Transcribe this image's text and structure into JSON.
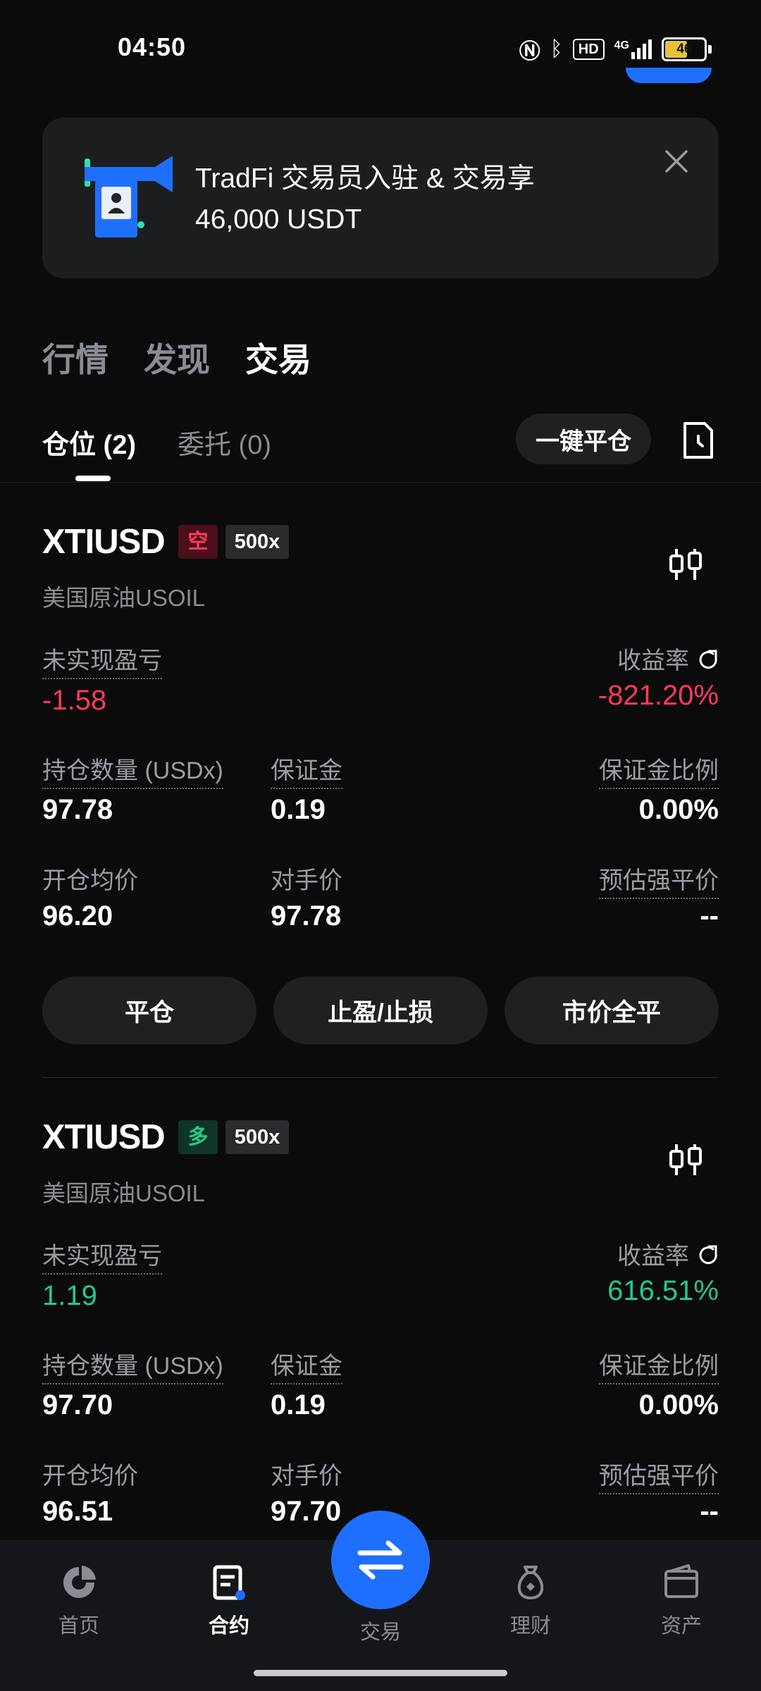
{
  "status": {
    "time": "04:50",
    "hd": "HD",
    "net": "4G",
    "battery": "46"
  },
  "banner": {
    "title": "TradFi 交易员入驻 & 交易享",
    "subtitle": "46,000 USDT"
  },
  "top_tabs": [
    "行情",
    "发现",
    "交易"
  ],
  "sub_tabs": {
    "positions": "仓位 (2)",
    "orders": "委托 (0)"
  },
  "close_all_label": "一键平仓",
  "positions": [
    {
      "symbol": "XTIUSD",
      "side": "空",
      "leverage": "500x",
      "name": "美国原油USOIL",
      "pnl_label": "未实现盈亏",
      "pnl": "-1.58",
      "roi_label": "收益率",
      "roi": "-821.20%",
      "qty_label": "持仓数量 (USDx)",
      "qty": "97.78",
      "margin_label": "保证金",
      "margin": "0.19",
      "margin_ratio_label": "保证金比例",
      "margin_ratio": "0.00%",
      "entry_label": "开仓均价",
      "entry": "96.20",
      "counter_label": "对手价",
      "counter": "97.78",
      "liq_label": "预估强平价",
      "liq": "--"
    },
    {
      "symbol": "XTIUSD",
      "side": "多",
      "leverage": "500x",
      "name": "美国原油USOIL",
      "pnl_label": "未实现盈亏",
      "pnl": "1.19",
      "roi_label": "收益率",
      "roi": "616.51%",
      "qty_label": "持仓数量 (USDx)",
      "qty": "97.70",
      "margin_label": "保证金",
      "margin": "0.19",
      "margin_ratio_label": "保证金比例",
      "margin_ratio": "0.00%",
      "entry_label": "开仓均价",
      "entry": "96.51",
      "counter_label": "对手价",
      "counter": "97.70",
      "liq_label": "预估强平价",
      "liq": "--"
    }
  ],
  "actions": [
    "平仓",
    "止盈/止损",
    "市价全平"
  ],
  "nav": [
    "首页",
    "合约",
    "交易",
    "理财",
    "资产"
  ],
  "colors": {
    "negative": "#ff3b5c",
    "positive": "#26c98a",
    "accent": "#1f6fff"
  }
}
